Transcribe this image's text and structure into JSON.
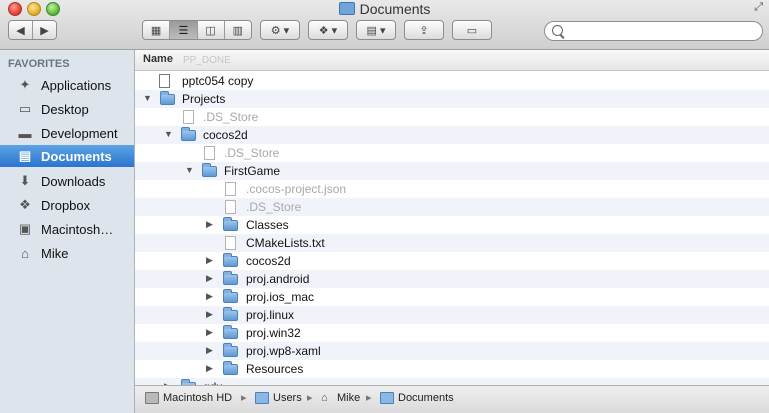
{
  "window": {
    "title": "Documents"
  },
  "toolbar": {
    "view_buttons": [
      "icon-view",
      "list-view",
      "column-view",
      "coverflow-view"
    ],
    "action_label": "⚙",
    "dropbox_label": "Dropbox",
    "arrange_label": "Arrange",
    "share_label": "Share",
    "tags_label": "Tags",
    "search_placeholder": ""
  },
  "sidebar": {
    "heading": "FAVORITES",
    "items": [
      {
        "label": "Applications",
        "icon": "applications-icon"
      },
      {
        "label": "Desktop",
        "icon": "desktop-icon"
      },
      {
        "label": "Development",
        "icon": "folder-icon"
      },
      {
        "label": "Documents",
        "icon": "documents-icon",
        "selected": true
      },
      {
        "label": "Downloads",
        "icon": "downloads-icon"
      },
      {
        "label": "Dropbox",
        "icon": "dropbox-icon"
      },
      {
        "label": "Macintosh…",
        "icon": "hard-drive-icon"
      },
      {
        "label": "Mike",
        "icon": "home-icon"
      }
    ]
  },
  "list": {
    "column_header": "Name",
    "ghost_header": "PP_DONE",
    "rows": [
      {
        "name": "pptc054 copy",
        "type": "file",
        "depth": 0,
        "dim": false
      },
      {
        "name": "Projects",
        "type": "folder",
        "depth": 0,
        "expanded": true
      },
      {
        "name": ".DS_Store",
        "type": "file",
        "depth": 1,
        "dim": true
      },
      {
        "name": "cocos2d",
        "type": "folder",
        "depth": 1,
        "expanded": true
      },
      {
        "name": ".DS_Store",
        "type": "file",
        "depth": 2,
        "dim": true
      },
      {
        "name": "FirstGame",
        "type": "folder",
        "depth": 2,
        "expanded": true
      },
      {
        "name": ".cocos-project.json",
        "type": "file",
        "depth": 3,
        "dim": true
      },
      {
        "name": ".DS_Store",
        "type": "file",
        "depth": 3,
        "dim": true
      },
      {
        "name": "Classes",
        "type": "folder",
        "depth": 3,
        "expanded": false
      },
      {
        "name": "CMakeLists.txt",
        "type": "file",
        "depth": 3,
        "dim": false
      },
      {
        "name": "cocos2d",
        "type": "folder",
        "depth": 3,
        "expanded": false
      },
      {
        "name": "proj.android",
        "type": "folder",
        "depth": 3,
        "expanded": false
      },
      {
        "name": "proj.ios_mac",
        "type": "folder",
        "depth": 3,
        "expanded": false
      },
      {
        "name": "proj.linux",
        "type": "folder",
        "depth": 3,
        "expanded": false
      },
      {
        "name": "proj.win32",
        "type": "folder",
        "depth": 3,
        "expanded": false
      },
      {
        "name": "proj.wp8-xaml",
        "type": "folder",
        "depth": 3,
        "expanded": false
      },
      {
        "name": "Resources",
        "type": "folder",
        "depth": 3,
        "expanded": false
      },
      {
        "name": "gdx",
        "type": "folder",
        "depth": 1,
        "expanded": false
      }
    ]
  },
  "pathbar": {
    "items": [
      {
        "label": "Macintosh HD",
        "icon": "hard-drive-icon"
      },
      {
        "label": "Users",
        "icon": "folder-icon"
      },
      {
        "label": "Mike",
        "icon": "home-icon"
      },
      {
        "label": "Documents",
        "icon": "folder-icon"
      }
    ]
  }
}
